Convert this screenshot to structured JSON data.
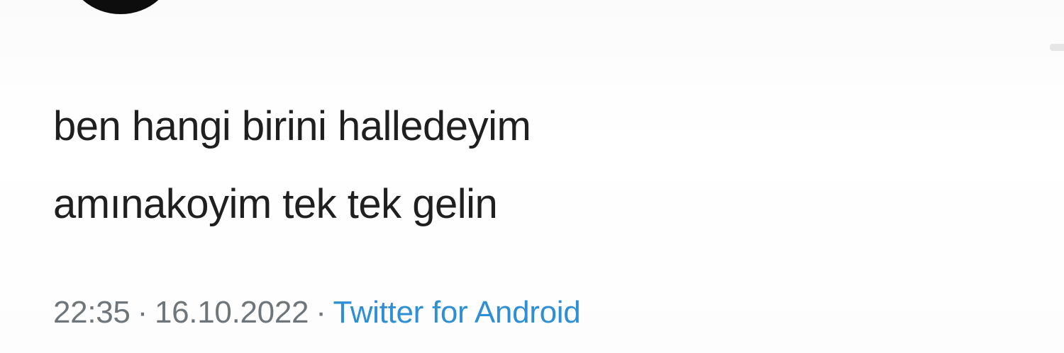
{
  "tweet": {
    "text_lines": [
      "ben hangi birini halledeyim",
      "amınakoyim tek tek gelin"
    ],
    "time": "22:35",
    "date": "16.10.2022",
    "separator": "·",
    "source": "Twitter for Android"
  },
  "colors": {
    "text": "#1f1f1f",
    "meta": "#6f767b",
    "link": "#2f8fd4"
  },
  "icons": {
    "avatar": "profile-avatar"
  }
}
